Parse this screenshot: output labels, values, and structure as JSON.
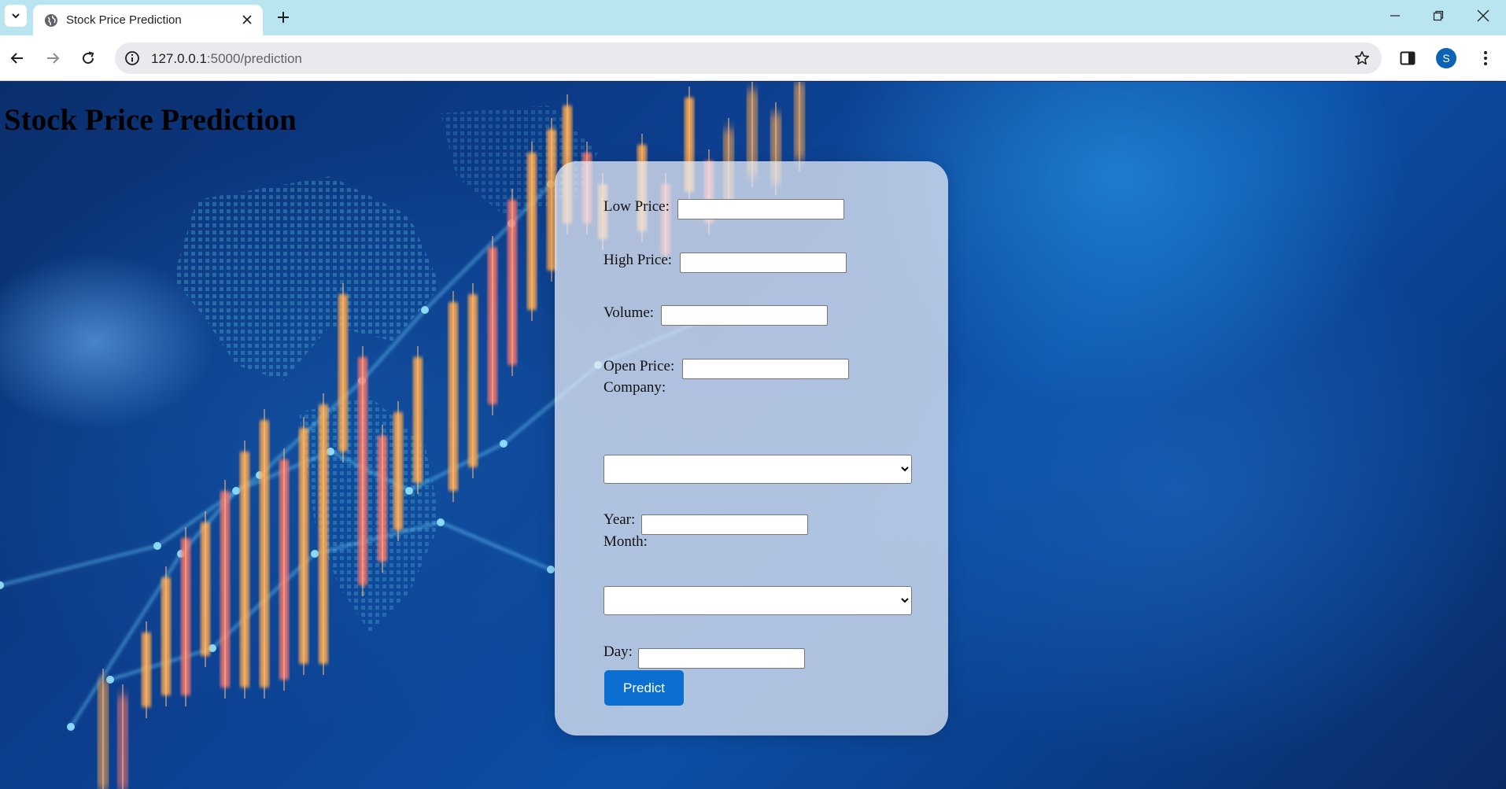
{
  "browser": {
    "tab_title": "Stock Price Prediction",
    "url_host": "127.0.0.1",
    "url_path": ":5000/prediction",
    "profile_initial": "S"
  },
  "page": {
    "title": "Stock Price Prediction"
  },
  "form": {
    "low_price_label": "Low Price:",
    "high_price_label": "High Price:",
    "volume_label": "Volume:",
    "open_price_label": "Open Price:",
    "company_label": "Company:",
    "year_label": "Year:",
    "month_label": "Month:",
    "day_label": "Day:",
    "predict_label": "Predict"
  },
  "colors": {
    "accent": "#0a6fd1",
    "tabbar": "#b9e5f1"
  }
}
